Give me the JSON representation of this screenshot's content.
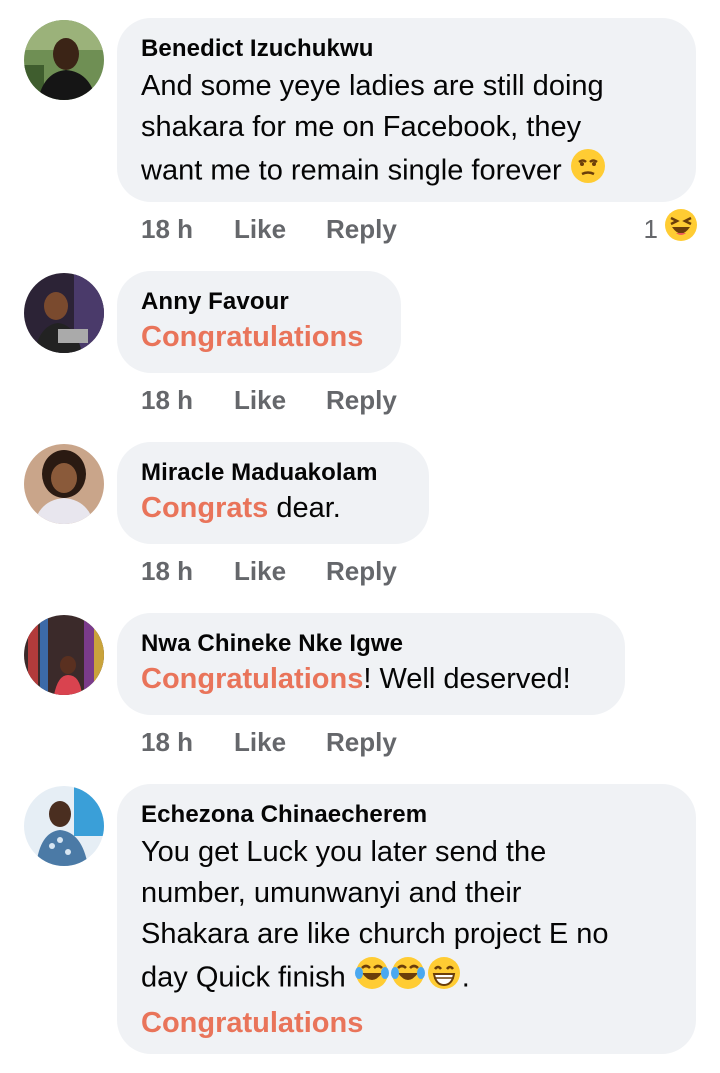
{
  "comments": [
    {
      "author": "Benedict Izuchukwu",
      "text_parts": [
        "And some yeye ladies are still doing",
        "shakara for me on Facebook, they",
        "want me to remain single forever"
      ],
      "time": "18 h",
      "like": "Like",
      "reply": "Reply",
      "reaction_count": "1",
      "reaction_icon": "laughing-squint-emoji",
      "text_emoji": "unamused-emoji"
    },
    {
      "author": "Anny Favour",
      "highlight": "Congratulations",
      "time": "18 h",
      "like": "Like",
      "reply": "Reply"
    },
    {
      "author": "Miracle Maduakolam",
      "highlight": "Congrats",
      "rest": " dear.",
      "time": "18 h",
      "like": "Like",
      "reply": "Reply"
    },
    {
      "author": "Nwa Chineke Nke Igwe",
      "highlight": "Congratulations",
      "rest": "! Well deserved!",
      "time": "18 h",
      "like": "Like",
      "reply": "Reply"
    },
    {
      "author": "Echezona Chinaecherem",
      "text_lines": [
        "You get Luck you later send the",
        "number,  umunwanyi and their",
        "Shakara are like church project E no",
        "day Quick finish"
      ],
      "line_end": ".",
      "highlight": "Congratulations",
      "text_emojis": [
        "tears-of-joy-emoji",
        "tears-of-joy-emoji",
        "grinning-emoji"
      ]
    }
  ],
  "colors": {
    "bubble": "#f0f2f5",
    "highlight": "#e9745a",
    "meta": "#65676b"
  }
}
